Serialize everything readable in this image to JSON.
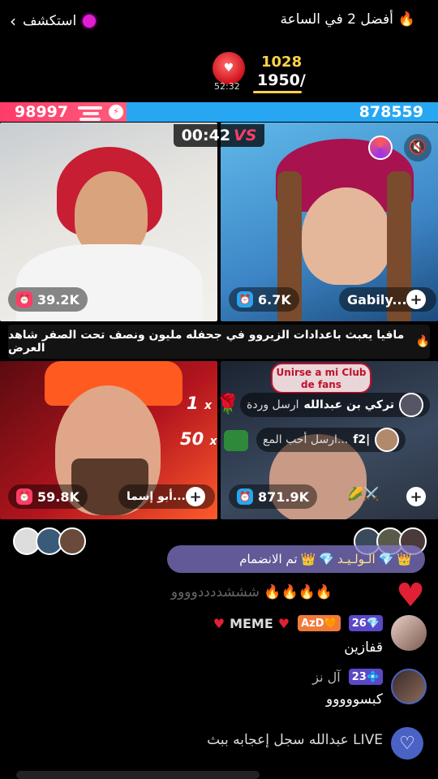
{
  "top": {
    "explore_label": "استكشف",
    "ranking_label": "أفضل 2 في الساعة"
  },
  "score": {
    "current": "1028",
    "target": "1950/",
    "timer": "52:32"
  },
  "battle": {
    "red_score": "98997",
    "blue_score": "878559",
    "countdown": "00:42",
    "vs_label": "VS"
  },
  "tiles": [
    {
      "likes": "39.2K",
      "name": ""
    },
    {
      "likes": "6.7K",
      "name": "Gabily..."
    },
    {
      "likes": "59.8K",
      "name": "أبو إسما..."
    },
    {
      "likes": "871.9K",
      "name": ""
    }
  ],
  "banner": {
    "text": "مافيا يعبث باعدادات الزيروو في جحفله مليون ونصف تحت الصفر شاهد العرض"
  },
  "gifts": {
    "count_a": "1",
    "count_b": "50",
    "multiplier": "x"
  },
  "club_sign": {
    "line1": "Unirse a mi Club",
    "line2": "de fans"
  },
  "gift_notes": [
    {
      "user": "تركي بن عبدالله",
      "action": "ارسل وردة"
    },
    {
      "user": "f2|",
      "action": "ارسل أحب المع..."
    }
  ],
  "join_notice": {
    "user": "الـولـيـد",
    "action": "تم الانضمام"
  },
  "comments": {
    "faded": "شششددددوووو",
    "c1_name": "MEME",
    "c1_badge": "AzD",
    "c1_level": "26",
    "c1_msg": "قفازين",
    "c2_name": "آل نز",
    "c2_level": "23",
    "c2_msg": "كبسووووو",
    "c3_msg": "عبدالله سجل إعجابه ببث LIVE"
  },
  "colors": {
    "red_team": "#ff3c69",
    "blue_team": "#27a7f2",
    "gold": "#ffd24a"
  }
}
